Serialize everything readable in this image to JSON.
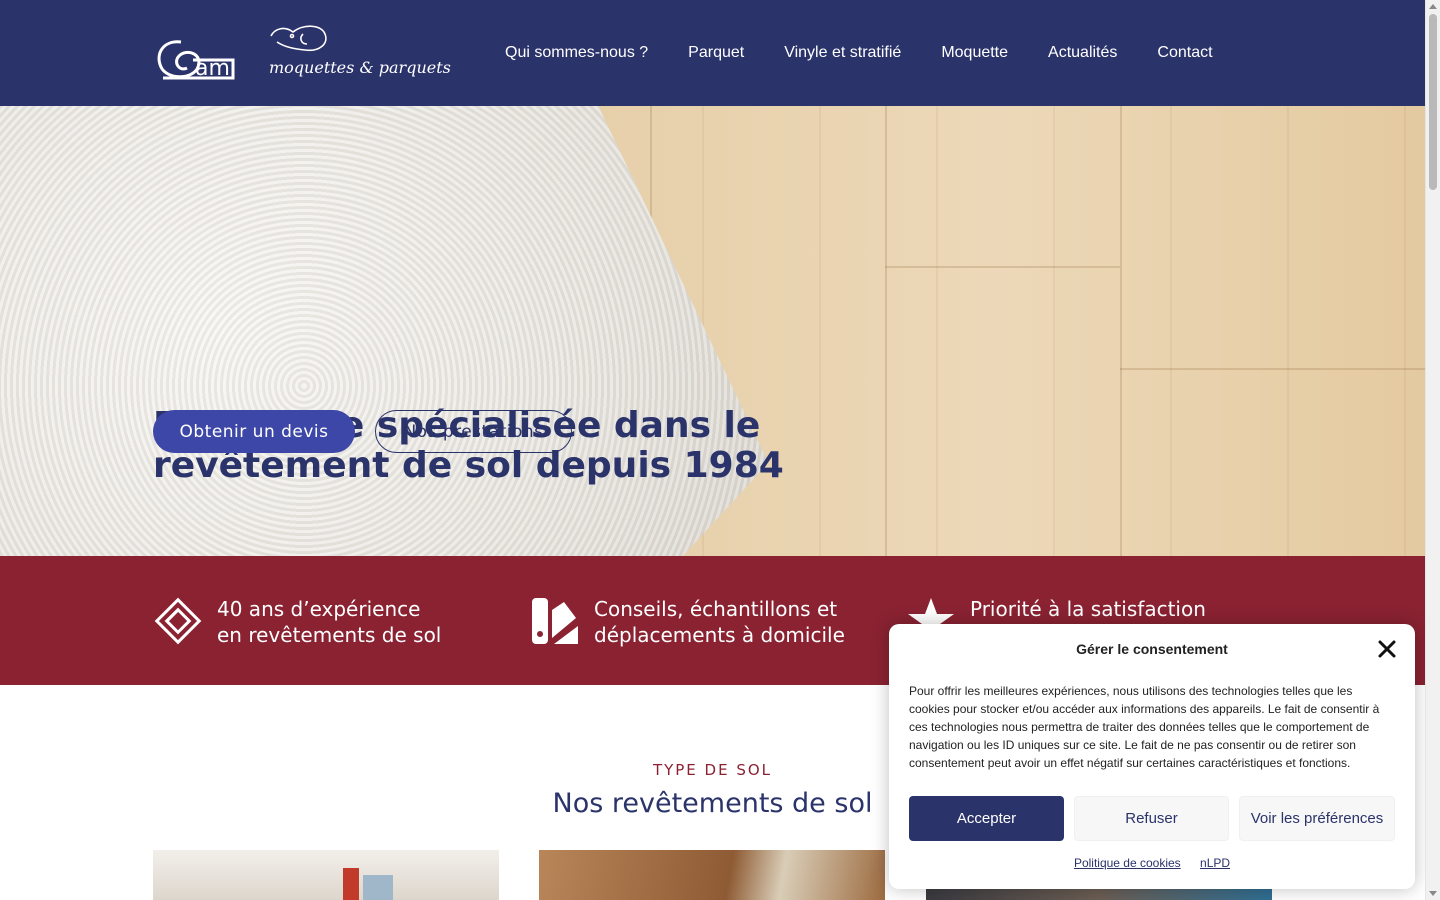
{
  "header": {
    "logo_text": "moquettes & parquets",
    "nav": [
      "Qui sommes-nous ?",
      "Parquet",
      "Vinyle et stratifié",
      "Moquette",
      "Actualités",
      "Contact"
    ]
  },
  "hero": {
    "title_line1": "Entreprise spécialisée dans le",
    "title_line2": "revêtement de sol depuis 1984",
    "primary_button": "Obtenir un devis",
    "secondary_button": "Nos prestations"
  },
  "features": [
    {
      "icon": "diamond-tile-icon",
      "line1": "40 ans d’expérience",
      "line2": "en revêtements de sol"
    },
    {
      "icon": "swatch-palette-icon",
      "line1": "Conseils, échantillons et",
      "line2": "déplacements à domicile"
    },
    {
      "icon": "star-icon",
      "line1": "Priorité à la satisfaction",
      "line2": ""
    }
  ],
  "section": {
    "eyebrow": "TYPE DE SOL",
    "title": "Nos revêtements de sol"
  },
  "consent": {
    "title": "Gérer le consentement",
    "body": "Pour offrir les meilleures expériences, nous utilisons des technologies telles que les cookies pour stocker et/ou accéder aux informations des appareils. Le fait de consentir à ces technologies nous permettra de traiter des données telles que le comportement de navigation ou les ID uniques sur ce site. Le fait de ne pas consentir ou de retirer son consentement peut avoir un effet négatif sur certaines caractéristiques et fonctions.",
    "accept": "Accepter",
    "refuse": "Refuser",
    "preferences": "Voir les préférences",
    "link_cookies": "Politique de cookies",
    "link_nlpd": "nLPD"
  },
  "colors": {
    "header_bg": "#2b336b",
    "band_bg": "#8a2232",
    "primary_button": "#3d47a8"
  }
}
